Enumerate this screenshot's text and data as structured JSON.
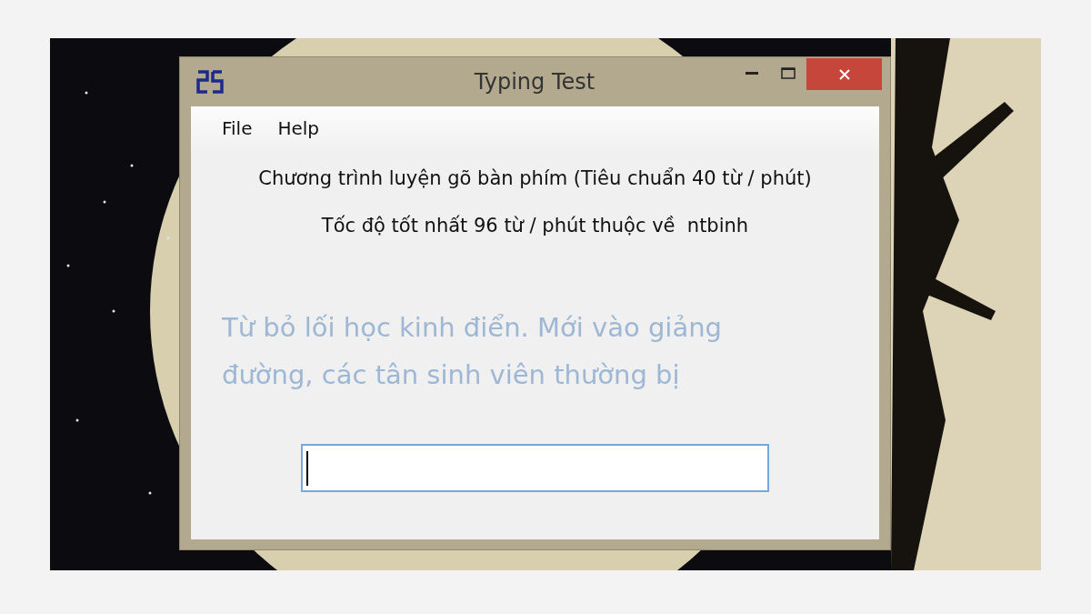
{
  "window": {
    "title": "Typing Test"
  },
  "menu": [
    {
      "label": "File"
    },
    {
      "label": "Help"
    }
  ],
  "heading": "Chương trình luyện gõ bàn phím (Tiêu chuẩn 40 từ / phút)",
  "best_score": "Tốc độ tốt nhất 96 từ / phút thuộc về  ntbinh",
  "sample_text": "Từ bỏ lối học kinh điển. Mới vào giảng đường, các tân sinh viên thường bị",
  "typing_field": {
    "focused": true
  }
}
